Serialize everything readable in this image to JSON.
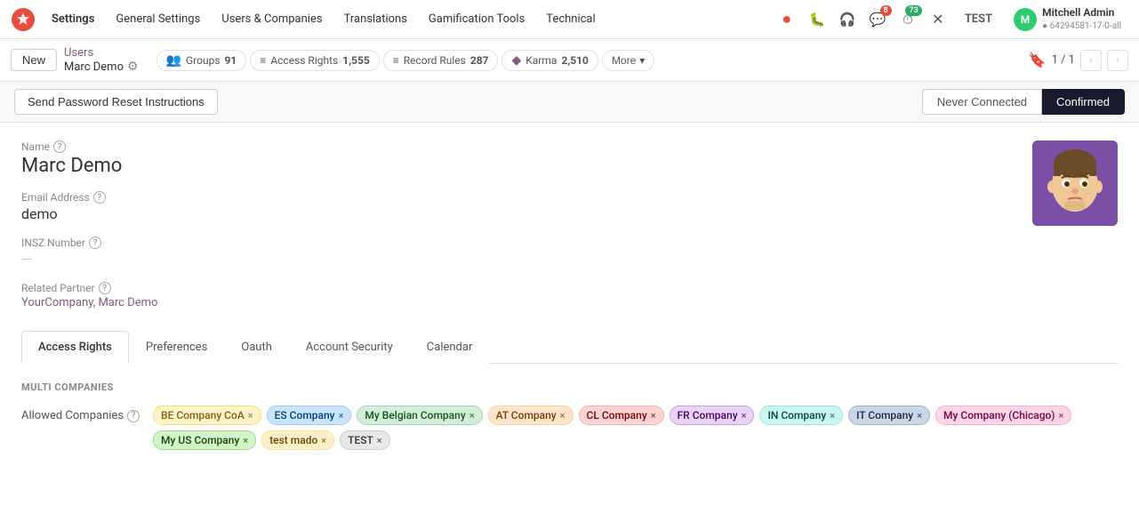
{
  "app": {
    "logo_text": "⚙",
    "nav_items": [
      "General Settings",
      "Users & Companies",
      "Translations",
      "Gamification Tools",
      "Technical"
    ],
    "active_nav": "Settings"
  },
  "topnav_icons": [
    {
      "name": "red-dot-icon",
      "symbol": "●",
      "color": "#e74c3c",
      "badge": null
    },
    {
      "name": "bug-icon",
      "symbol": "🐛",
      "color": "#555",
      "badge": null
    },
    {
      "name": "headset-icon",
      "symbol": "🎧",
      "color": "#555",
      "badge": null
    },
    {
      "name": "chat-icon",
      "symbol": "💬",
      "color": "#555",
      "badge": "8"
    },
    {
      "name": "clock-icon",
      "symbol": "⏱",
      "color": "#555",
      "badge": "73",
      "badge_green": true
    }
  ],
  "topnav_actions": [
    {
      "name": "tools-icon",
      "symbol": "✗",
      "color": "#555"
    },
    {
      "name": "test-label",
      "text": "TEST"
    }
  ],
  "user": {
    "avatar_letter": "M",
    "avatar_bg": "#2ecc71",
    "name": "Mitchell Admin",
    "id": "● 64294581-17-0-all"
  },
  "toolbar": {
    "new_label": "New",
    "breadcrumb_parent": "Users",
    "breadcrumb_current": "Marc Demo",
    "stats": [
      {
        "key": "groups",
        "icon": "👥",
        "label": "Groups",
        "value": "91"
      },
      {
        "key": "access",
        "icon": "≡",
        "label": "Access Rights",
        "value": "1,555"
      },
      {
        "key": "record",
        "icon": "≡",
        "label": "Record Rules",
        "value": "287"
      },
      {
        "key": "karma",
        "icon": "◆",
        "label": "Karma",
        "value": "2,510"
      }
    ],
    "more_label": "More",
    "pagination": "1 / 1"
  },
  "status": {
    "reset_btn": "Send Password Reset Instructions",
    "never_connected": "Never Connected",
    "confirmed": "Confirmed"
  },
  "form": {
    "name_label": "Name",
    "name_value": "Marc Demo",
    "email_label": "Email Address",
    "email_value": "demo",
    "insz_label": "INSZ Number",
    "related_partner_label": "Related Partner",
    "related_partner_value": "YourCompany, Marc Demo"
  },
  "tabs": [
    {
      "key": "access-rights",
      "label": "Access Rights",
      "active": true
    },
    {
      "key": "preferences",
      "label": "Preferences",
      "active": false
    },
    {
      "key": "oauth",
      "label": "Oauth",
      "active": false
    },
    {
      "key": "account-security",
      "label": "Account Security",
      "active": false
    },
    {
      "key": "calendar",
      "label": "Calendar",
      "active": false
    }
  ],
  "multi_companies": {
    "section_title": "MULTI COMPANIES",
    "allowed_label": "Allowed Companies",
    "companies": [
      {
        "label": "BE Company CoA",
        "color_class": "tag-yellow"
      },
      {
        "label": "ES Company",
        "color_class": "tag-blue"
      },
      {
        "label": "My Belgian Company",
        "color_class": "tag-green"
      },
      {
        "label": "AT Company",
        "color_class": "tag-orange"
      },
      {
        "label": "CL Company",
        "color_class": "tag-red"
      },
      {
        "label": "FR Company",
        "color_class": "tag-purple"
      },
      {
        "label": "IN Company",
        "color_class": "tag-teal"
      },
      {
        "label": "IT Company",
        "color_class": "tag-dark"
      },
      {
        "label": "My Company (Chicago)",
        "color_class": "tag-pink"
      },
      {
        "label": "My US Company",
        "color_class": "tag-lime"
      },
      {
        "label": "test mado",
        "color_class": "tag-amber"
      },
      {
        "label": "TEST",
        "color_class": "tag-gray"
      }
    ]
  }
}
